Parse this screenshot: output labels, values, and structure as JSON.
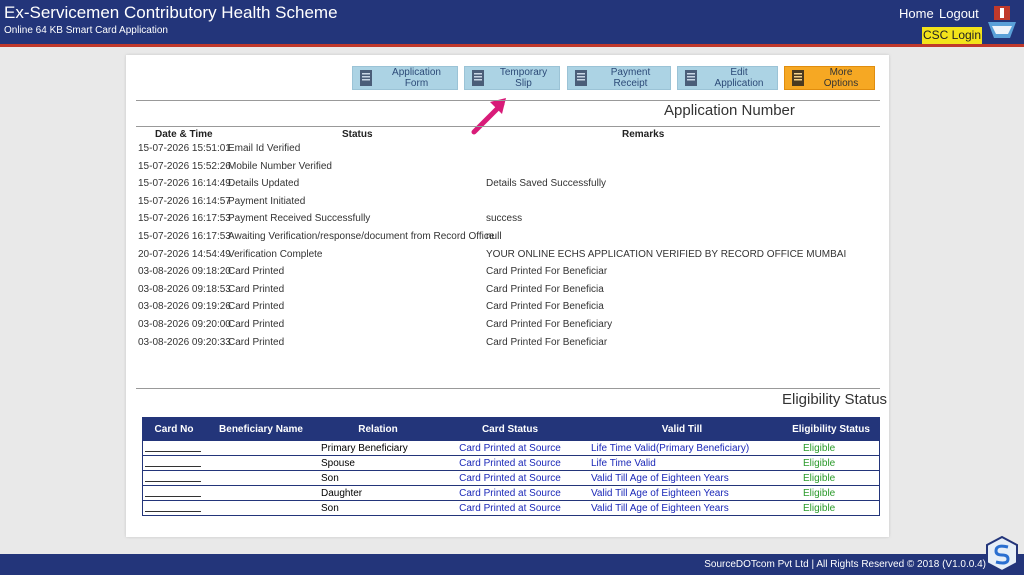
{
  "header": {
    "title": "Ex-Servicemen Contributory Health Scheme",
    "subtitle": "Online 64 KB Smart Card Application",
    "home": "Home",
    "logout": "Logout",
    "csc_login": "CSC Login"
  },
  "toolbar": {
    "application_form": "Application Form",
    "temporary_slip": "Temporary Slip",
    "payment_receipt": "Payment Receipt",
    "edit_application": "Edit Application",
    "more_options": "More Options"
  },
  "application_number_label": "Application Number",
  "status_table": {
    "headers": {
      "datetime": "Date & Time",
      "status": "Status",
      "remarks": "Remarks"
    },
    "rows": [
      {
        "datetime": "15-07-2026 15:51:01",
        "status": "Email Id Verified",
        "remarks": ""
      },
      {
        "datetime": "15-07-2026 15:52:26",
        "status": "Mobile Number Verified",
        "remarks": ""
      },
      {
        "datetime": "15-07-2026 16:14:49",
        "status": "Details Updated",
        "remarks": "Details Saved Successfully"
      },
      {
        "datetime": "15-07-2026 16:14:57",
        "status": "Payment Initiated",
        "remarks": ""
      },
      {
        "datetime": "15-07-2026 16:17:53",
        "status": "Payment Received Successfully",
        "remarks": "success"
      },
      {
        "datetime": "15-07-2026 16:17:53",
        "status": "Awaiting Verification/response/document from Record Office",
        "remarks": "null"
      },
      {
        "datetime": "20-07-2026 14:54:49",
        "status": "Verification Complete",
        "remarks": "YOUR ONLINE ECHS APPLICATION VERIFIED BY RECORD OFFICE MUMBAI"
      },
      {
        "datetime": "03-08-2026 09:18:20",
        "status": "Card Printed",
        "remarks": "Card Printed For Beneficiar"
      },
      {
        "datetime": "03-08-2026 09:18:53",
        "status": "Card Printed",
        "remarks": "Card Printed For Beneficia"
      },
      {
        "datetime": "03-08-2026 09:19:26",
        "status": "Card Printed",
        "remarks": "Card Printed For Beneficia"
      },
      {
        "datetime": "03-08-2026 09:20:00",
        "status": "Card Printed",
        "remarks": "Card Printed For Beneficiary"
      },
      {
        "datetime": "03-08-2026 09:20:33",
        "status": "Card Printed",
        "remarks": "Card Printed For Beneficiar"
      }
    ]
  },
  "eligibility": {
    "title": "Eligibility Status",
    "headers": {
      "card_no": "Card No",
      "name": "Beneficiary Name",
      "relation": "Relation",
      "card_status": "Card Status",
      "valid_till": "Valid Till",
      "status": "Eligibility Status"
    },
    "rows": [
      {
        "relation": "Primary Beneficiary",
        "card_status": "Card Printed at Source",
        "valid_till": "Life Time Valid(Primary Beneficiary)",
        "status": "Eligible"
      },
      {
        "relation": "Spouse",
        "card_status": "Card Printed at Source",
        "valid_till": "Life Time Valid",
        "status": "Eligible"
      },
      {
        "relation": "Son",
        "card_status": "Card Printed at Source",
        "valid_till": "Valid Till Age of Eighteen Years",
        "status": "Eligible"
      },
      {
        "relation": "Daughter",
        "card_status": "Card Printed at Source",
        "valid_till": "Valid Till Age of Eighteen Years",
        "status": "Eligible"
      },
      {
        "relation": "Son",
        "card_status": "Card Printed at Source",
        "valid_till": "Valid Till Age of Eighteen Years",
        "status": "Eligible"
      }
    ]
  },
  "footer": "SourceDOTcom Pvt Ltd | All Rights Reserved © 2018 (V1.0.0.4)",
  "colors": {
    "navy": "#23357a",
    "eligible": "#2a9a2a",
    "valid_blue": "#1b28b8",
    "arrow": "#d81b78"
  }
}
